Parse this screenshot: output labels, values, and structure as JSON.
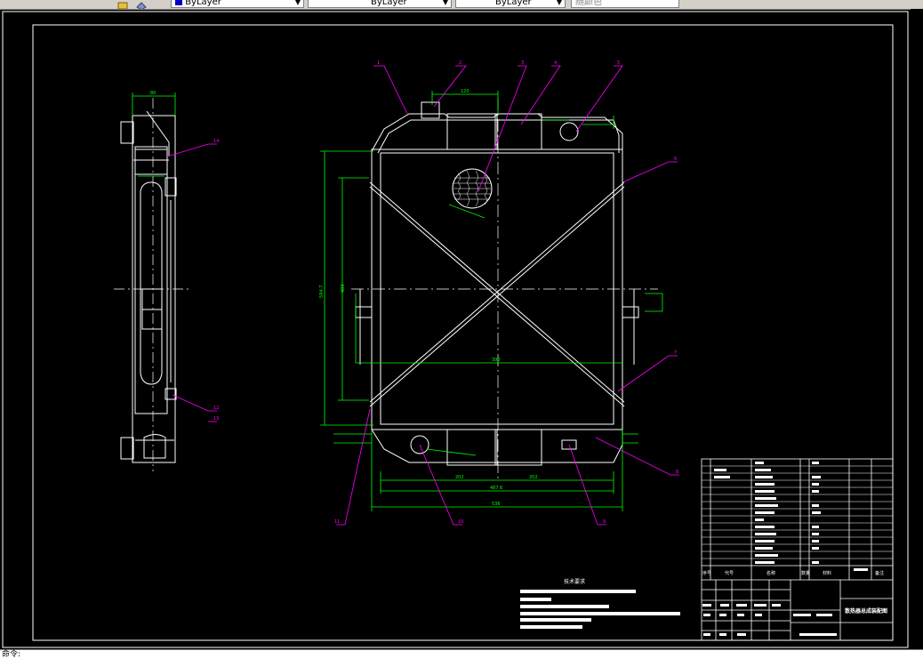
{
  "toolbar": {
    "layer_color_label": "ByLayer",
    "linetype_label": "ByLayer",
    "lineweight_label": "ByLayer",
    "plotstyle_label": "随颜色"
  },
  "drawing": {
    "part_numbers": [
      "1",
      "2",
      "3",
      "4",
      "5",
      "6",
      "7",
      "8",
      "9",
      "10",
      "11",
      "12",
      "13",
      "14"
    ],
    "dims": {
      "top_width": "120",
      "side_width": "80",
      "height_main": "594.7",
      "height_inner": "480",
      "bottom_width_1": "487.6",
      "bottom_width_2": "536",
      "half_left": "202",
      "half_right": "202",
      "span": "390"
    },
    "notes_title": "技术要求",
    "title_block": {
      "drawing_title": "散热器总成装配图",
      "header_cols": [
        "序号",
        "代号",
        "名称",
        "数量",
        "材料",
        "备注"
      ]
    },
    "colors": {
      "outline": "#ffffff",
      "dimension": "#00ff00",
      "leader": "#ff00ff",
      "frame": "#ffffff"
    }
  },
  "status": {
    "prompt": "命令:"
  }
}
